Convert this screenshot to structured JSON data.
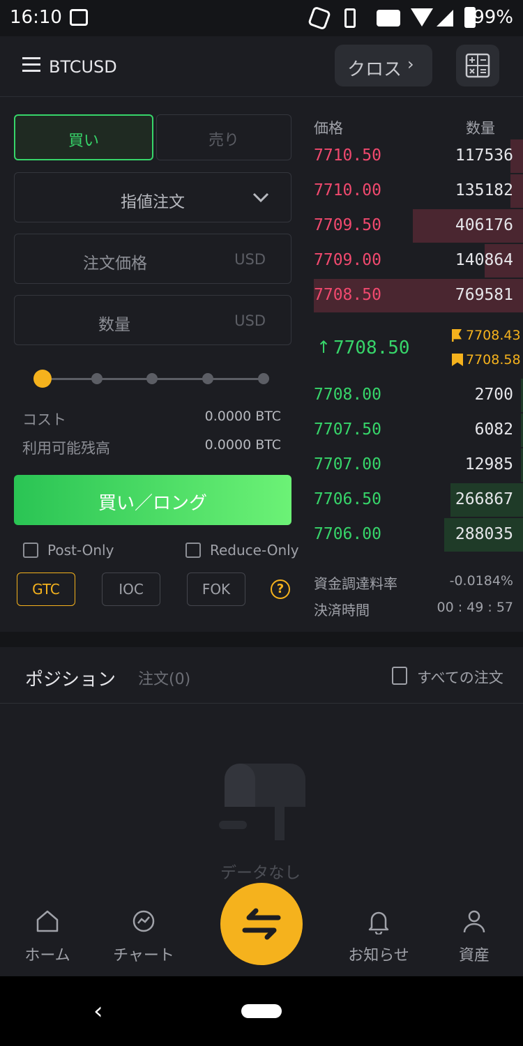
{
  "status": {
    "time": "16:10",
    "battery": "99%"
  },
  "header": {
    "symbol": "BTCUSD",
    "margin_mode": "クロス"
  },
  "form": {
    "buy_tab": "買い",
    "sell_tab": "売り",
    "order_type": "指値注文",
    "price_placeholder": "注文価格",
    "price_unit": "USD",
    "qty_placeholder": "数量",
    "qty_unit": "USD",
    "cost_label": "コスト",
    "cost_value": "0.0000 BTC",
    "available_label": "利用可能残高",
    "available_value": "0.0000 BTC",
    "submit": "買い／ロング",
    "post_only": "Post-Only",
    "reduce_only": "Reduce-Only",
    "tif": [
      "GTC",
      "IOC",
      "FOK"
    ],
    "slider_level": 0
  },
  "orderbook": {
    "price_header": "価格",
    "qty_header": "数量",
    "asks": [
      {
        "price": "7710.50",
        "qty": "117536"
      },
      {
        "price": "7710.00",
        "qty": "135182"
      },
      {
        "price": "7709.50",
        "qty": "406176"
      },
      {
        "price": "7709.00",
        "qty": "140864"
      },
      {
        "price": "7708.50",
        "qty": "769581"
      }
    ],
    "last_price": "7708.50",
    "mark_price": "7708.43",
    "index_price": "7708.58",
    "bids": [
      {
        "price": "7708.00",
        "qty": "2700"
      },
      {
        "price": "7707.50",
        "qty": "6082"
      },
      {
        "price": "7707.00",
        "qty": "12985"
      },
      {
        "price": "7706.50",
        "qty": "266867"
      },
      {
        "price": "7706.00",
        "qty": "288035"
      }
    ],
    "funding_label": "資金調達料率",
    "funding_value": "-0.0184%",
    "settle_label": "決済時間",
    "settle_value": "00 : 49 : 57"
  },
  "tabs": {
    "positions": "ポジション",
    "orders": "注文(0)",
    "all_orders": "すべての注文"
  },
  "empty": {
    "text": "データなし"
  },
  "nav": {
    "home": "ホーム",
    "chart": "チャート",
    "notice": "お知らせ",
    "assets": "資産"
  },
  "colors": {
    "accent": "#f5b21d",
    "green": "#37d56a",
    "red": "#f0496e",
    "bg": "#1c1d22"
  }
}
